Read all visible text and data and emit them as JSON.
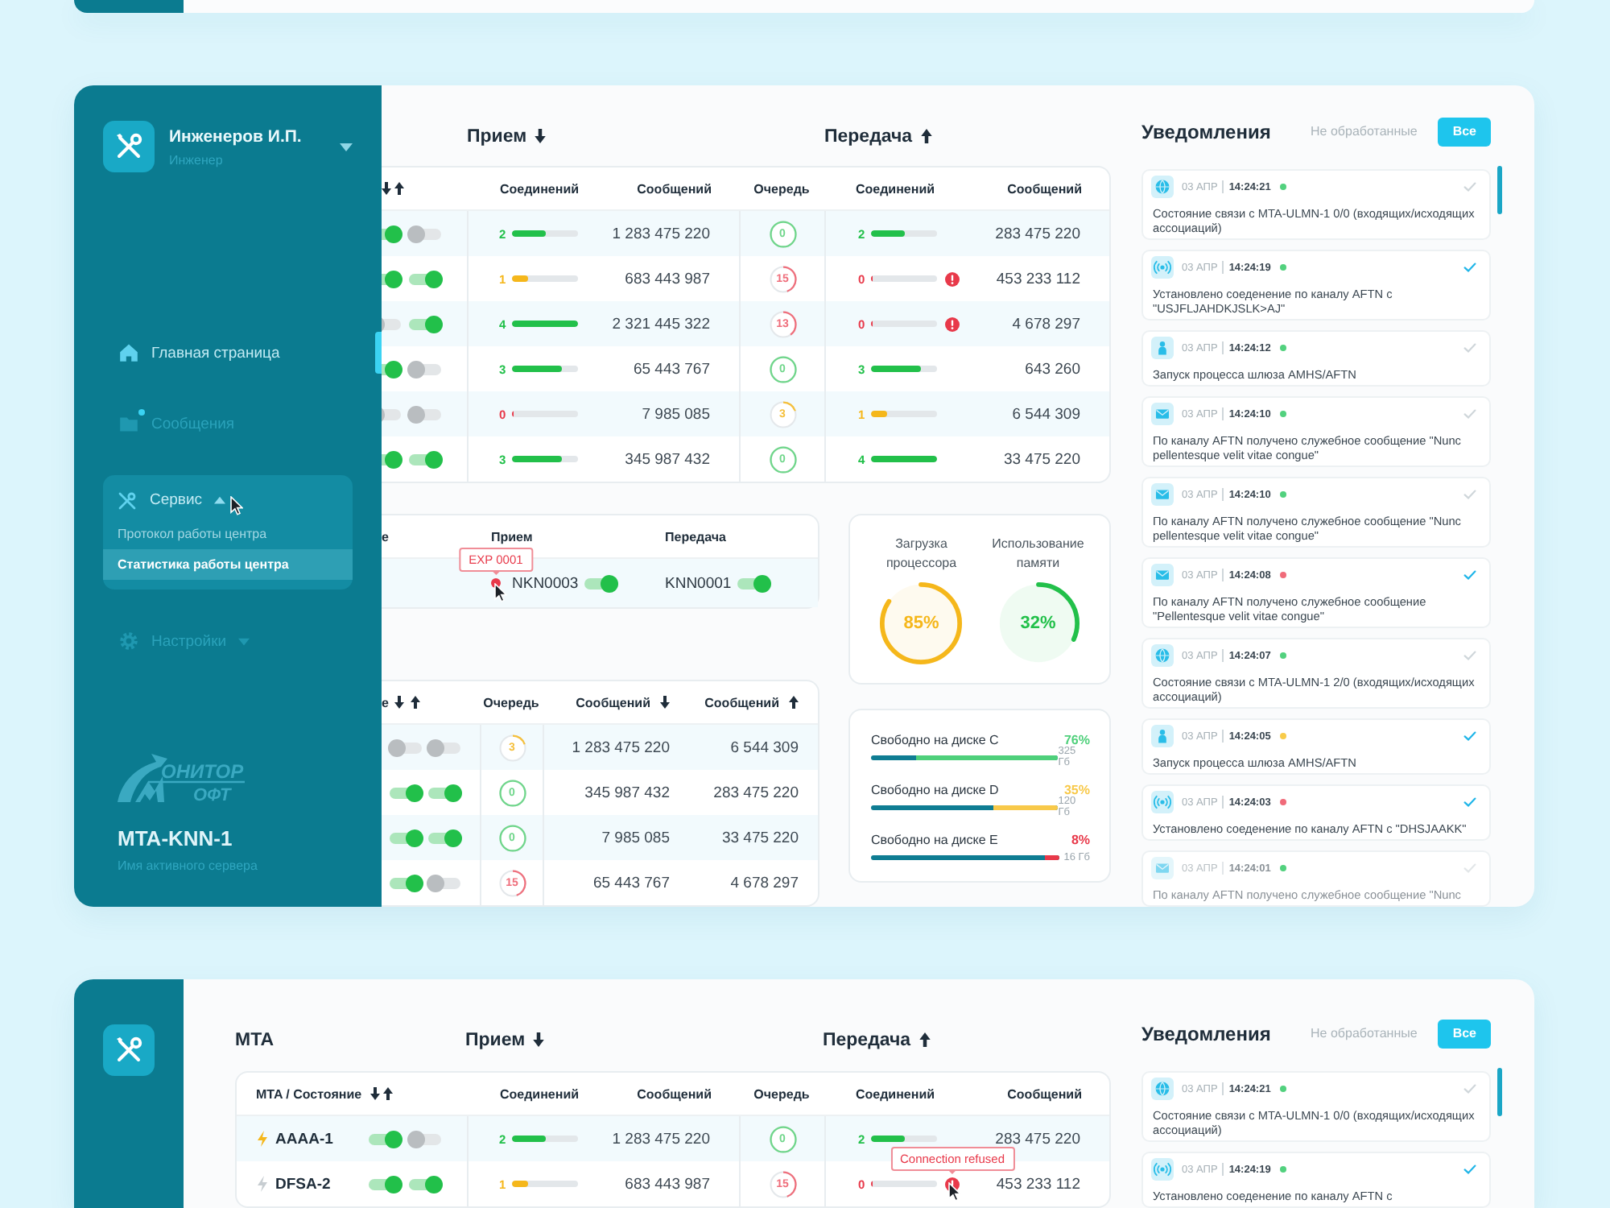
{
  "expanded_view": {
    "sidebar": {
      "user": {
        "name": "Инженеров И.П.",
        "role": "Инженер"
      },
      "nav": [
        {
          "kind": "home",
          "label": "Главная страница",
          "selected": true,
          "dimmed": false,
          "unread": false
        },
        {
          "kind": "folder",
          "label": "Сообщения",
          "selected": false,
          "dimmed": true,
          "unread": true
        },
        {
          "kind": "tools",
          "label": "Сервис",
          "selected": false,
          "dimmed": false,
          "unread": false,
          "expanded": true,
          "children": [
            {
              "label": "Протокол работы центра",
              "selected": false
            },
            {
              "label": "Статистика работы центра",
              "selected": true
            }
          ]
        },
        {
          "kind": "gear",
          "label": "Настройки",
          "selected": false,
          "dimmed": true,
          "unread": false,
          "expanded": false
        }
      ],
      "logo": {
        "line_1": "ОНИТОР",
        "line_2": "ОФТ"
      },
      "server": {
        "name": "MTA-KNN-1",
        "caption": "Имя активного сервера"
      }
    },
    "headings": {
      "receive": "Прием",
      "transmit": "Передача"
    },
    "mta_table": {
      "columns": [
        "Соединений",
        "Сообщений",
        "Очередь",
        "Соединений",
        "Сообщений"
      ],
      "rows": [
        {
          "toggles": [
            {
              "on": true
            },
            {
              "on": false
            }
          ],
          "rx": {
            "count": "2",
            "level": 0.5,
            "color": "#22c04a",
            "alert": false
          },
          "rx_messages": "1 283 475 220",
          "queue": {
            "value": "0",
            "level": 1,
            "color": "#6fd68a"
          },
          "tx": {
            "count": "2",
            "level": 0.5,
            "color": "#22c04a",
            "alert": false
          },
          "tx_messages": "283 475 220"
        },
        {
          "toggles": [
            {
              "on": true
            },
            {
              "on": true
            }
          ],
          "rx": {
            "count": "1",
            "level": 0.25,
            "color": "#f5b71b",
            "alert": false
          },
          "rx_messages": "683 443 987",
          "queue": {
            "value": "15",
            "level": 0.45,
            "color": "#ef6f7c"
          },
          "tx": {
            "count": "0",
            "level": 0,
            "color": "#e8394a",
            "alert": true
          },
          "tx_messages": "453 233 112"
        },
        {
          "toggles": [
            {
              "on": false
            },
            {
              "on": true
            }
          ],
          "rx": {
            "count": "4",
            "level": 1,
            "color": "#22c04a",
            "alert": false
          },
          "rx_messages": "2 321 445 322",
          "queue": {
            "value": "13",
            "level": 0.4,
            "color": "#ef6f7c"
          },
          "tx": {
            "count": "0",
            "level": 0,
            "color": "#e8394a",
            "alert": true
          },
          "tx_messages": "4 678 297"
        },
        {
          "toggles": [
            {
              "on": true
            },
            {
              "on": false
            }
          ],
          "rx": {
            "count": "3",
            "level": 0.75,
            "color": "#22c04a",
            "alert": false
          },
          "rx_messages": "65 443 767",
          "queue": {
            "value": "0",
            "level": 1,
            "color": "#6fd68a"
          },
          "tx": {
            "count": "3",
            "level": 0.75,
            "color": "#22c04a",
            "alert": false
          },
          "tx_messages": "643 260"
        },
        {
          "toggles": [
            {
              "on": false
            },
            {
              "on": false
            }
          ],
          "rx": {
            "count": "0",
            "level": 0,
            "color": "#e8394a",
            "alert": false
          },
          "rx_messages": "7 985 085",
          "queue": {
            "value": "3",
            "level": 0.2,
            "color": "#f5c03d"
          },
          "tx": {
            "count": "1",
            "level": 0.25,
            "color": "#f5b71b",
            "alert": false
          },
          "tx_messages": "6 544 309"
        },
        {
          "toggles": [
            {
              "on": true
            },
            {
              "on": true
            }
          ],
          "rx": {
            "count": "3",
            "level": 0.75,
            "color": "#22c04a",
            "alert": false
          },
          "rx_messages": "345 987 432",
          "queue": {
            "value": "0",
            "level": 1,
            "color": "#6fd68a"
          },
          "tx": {
            "count": "4",
            "level": 1,
            "color": "#22c04a",
            "alert": false
          },
          "tx_messages": "33 475 220"
        }
      ]
    },
    "channels_table": {
      "columns": [
        "е",
        "Прием",
        "Передача"
      ],
      "rows": [
        {
          "rx": {
            "name": "NKN0003",
            "on": true,
            "alert": true,
            "tooltip": "EXP 0001"
          },
          "tx": {
            "name": "KNN0001",
            "on": true,
            "alert": false
          }
        }
      ]
    },
    "queue_table": {
      "columns": [
        "е",
        "Очередь",
        "Сообщений",
        "Сообщений"
      ],
      "rows": [
        {
          "toggles": [
            {
              "on": false
            },
            {
              "on": false
            }
          ],
          "queue": {
            "value": "3",
            "level": 0.2,
            "color": "#f5c03d"
          },
          "rx_messages": "1 283 475 220",
          "tx_messages": "6 544 309"
        },
        {
          "toggles": [
            {
              "on": true
            },
            {
              "on": true
            }
          ],
          "queue": {
            "value": "0",
            "level": 1,
            "color": "#6fd68a"
          },
          "rx_messages": "345 987 432",
          "tx_messages": "283 475 220"
        },
        {
          "toggles": [
            {
              "on": true
            },
            {
              "on": true
            }
          ],
          "queue": {
            "value": "0",
            "level": 1,
            "color": "#6fd68a"
          },
          "rx_messages": "7 985 085",
          "tx_messages": "33 475 220"
        },
        {
          "toggles": [
            {
              "on": true
            },
            {
              "on": false
            }
          ],
          "queue": {
            "value": "15",
            "level": 0.45,
            "color": "#ef6f7c"
          },
          "rx_messages": "65 443 767",
          "tx_messages": "4 678 297"
        }
      ]
    },
    "system_load": [
      {
        "label": "Загрузка процессора",
        "value": "85%",
        "level": 0.85,
        "color": "#f5b71b"
      },
      {
        "label": "Использование памяти",
        "value": "32%",
        "level": 0.32,
        "color": "#22c04a"
      }
    ],
    "disks": [
      {
        "label": "Свободно на диске C",
        "value": "76%",
        "size": "325 Гб",
        "level": 0.76,
        "color": "#4fd07b"
      },
      {
        "label": "Свободно на диске D",
        "value": "35%",
        "size": "120 Гб",
        "level": 0.35,
        "color": "#f8c94a"
      },
      {
        "label": "Свободно на диске E",
        "value": "8%",
        "size": "16 Гб",
        "level": 0.08,
        "color": "#e8394a"
      }
    ],
    "notifications": {
      "title": "Уведомления",
      "tabs": [
        {
          "label": "Не обработанные",
          "selected": false
        },
        {
          "label": "Все",
          "selected": true
        }
      ],
      "items": [
        {
          "kind": "globe",
          "date": "03 АПР",
          "time": "14:24:21",
          "color": "#52d17e",
          "checked": false,
          "faded": false,
          "message": "Состояние связи с MTA-ULMN-1 0/0 (входящих/исходящих ассоциаций)"
        },
        {
          "kind": "signal",
          "date": "03 АПР",
          "time": "14:24:19",
          "color": "#52d17e",
          "checked": true,
          "faded": false,
          "message": "Установлено соеденение по каналу AFTN с \"USJFLJAHDKJSLK>AJ\""
        },
        {
          "kind": "person",
          "date": "03 АПР",
          "time": "14:24:12",
          "color": "#52d17e",
          "checked": false,
          "faded": false,
          "message": "Запуск процесса шлюза AMHS/AFTN"
        },
        {
          "kind": "mail",
          "date": "03 АПР",
          "time": "14:24:10",
          "color": "#52d17e",
          "checked": false,
          "faded": false,
          "message": "По каналу AFTN получено служебное сообщение \"Nunc pellentesque velit vitae congue\""
        },
        {
          "kind": "mail",
          "date": "03 АПР",
          "time": "14:24:10",
          "color": "#52d17e",
          "checked": false,
          "faded": false,
          "message": "По каналу AFTN получено служебное сообщение \"Nunc pellentesque velit vitae congue\""
        },
        {
          "kind": "mail",
          "date": "03 АПР",
          "time": "14:24:08",
          "color": "#f06b7a",
          "checked": true,
          "faded": false,
          "message": "По каналу AFTN получено служебное сообщение \"Pellentesque velit vitae congue\""
        },
        {
          "kind": "globe",
          "date": "03 АПР",
          "time": "14:24:07",
          "color": "#52d17e",
          "checked": false,
          "faded": false,
          "message": "Состояние связи с MTA-ULMN-1 2/0 (входящих/исходящих ассоциаций)"
        },
        {
          "kind": "person",
          "date": "03 АПР",
          "time": "14:24:05",
          "color": "#f8cb4a",
          "checked": true,
          "faded": false,
          "message": "Запуск процесса шлюза AMHS/AFTN"
        },
        {
          "kind": "signal",
          "date": "03 АПР",
          "time": "14:24:03",
          "color": "#f06b7a",
          "checked": true,
          "faded": false,
          "message": "Установлено соеденение по каналу AFTN с \"DHSJAAKK\""
        },
        {
          "kind": "mail",
          "date": "03 АПР",
          "time": "14:24:01",
          "color": "#52d17e",
          "checked": false,
          "faded": true,
          "message": "По каналу AFTN получено служебное сообщение \"Nunc"
        }
      ]
    }
  },
  "collapsed_view": {
    "headings": {
      "title": "MTA",
      "receive": "Прием",
      "transmit": "Передача"
    },
    "mta_table": {
      "columns": [
        "MTA / Состояние",
        "Соединений",
        "Сообщений",
        "Очередь",
        "Соединений",
        "Сообщений"
      ],
      "rows": [
        {
          "name": "AAAA-1",
          "active": true,
          "toggles": [
            {
              "on": true
            },
            {
              "on": false
            }
          ],
          "rx": {
            "count": "2",
            "level": 0.5,
            "color": "#22c04a",
            "alert": false
          },
          "rx_messages": "1 283 475 220",
          "queue": {
            "value": "0",
            "level": 1,
            "color": "#6fd68a"
          },
          "tx": {
            "count": "2",
            "level": 0.5,
            "color": "#22c04a",
            "alert": false
          },
          "tx_messages": "283 475 220"
        },
        {
          "name": "DFSA-2",
          "active": false,
          "toggles": [
            {
              "on": true
            },
            {
              "on": true
            }
          ],
          "rx": {
            "count": "1",
            "level": 0.25,
            "color": "#f5b71b",
            "alert": false
          },
          "rx_messages": "683 443 987",
          "queue": {
            "value": "15",
            "level": 0.45,
            "color": "#ef6f7c"
          },
          "tx": {
            "count": "0",
            "level": 0,
            "color": "#e8394a",
            "alert": true,
            "tooltip": "Connection refused"
          },
          "tx_messages": "453 233 112"
        }
      ]
    },
    "notifications": {
      "title": "Уведомления",
      "tabs": [
        {
          "label": "Не обработанные",
          "selected": false
        },
        {
          "label": "Все",
          "selected": true
        }
      ],
      "items": [
        {
          "kind": "globe",
          "date": "03 АПР",
          "time": "14:24:21",
          "color": "#52d17e",
          "checked": false,
          "faded": false,
          "message": "Состояние связи с MTA-ULMN-1 0/0 (входящих/исходящих ассоциаций)"
        },
        {
          "kind": "signal",
          "date": "03 АПР",
          "time": "14:24:19",
          "color": "#52d17e",
          "checked": true,
          "faded": false,
          "message": "Установлено соеденение по каналу AFTN с"
        }
      ]
    }
  }
}
